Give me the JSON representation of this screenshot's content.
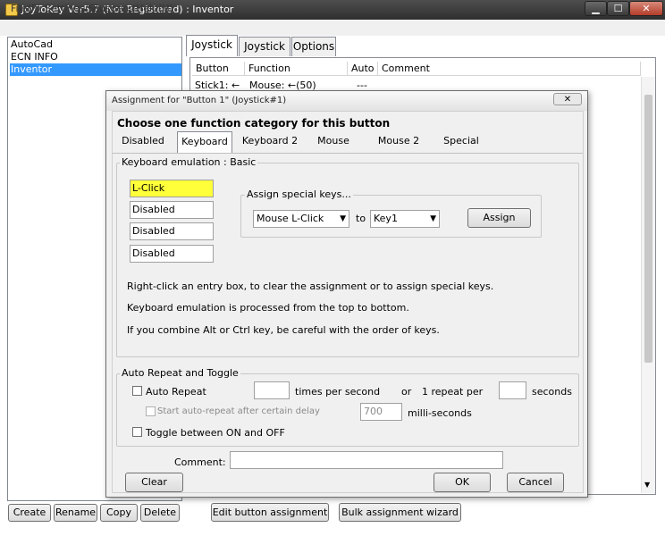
{
  "window": {
    "title": "JoyToKey Ver5.7 (Not Registered) : Inventor",
    "minimize": "▁",
    "maximize": "☐",
    "close": "✕"
  },
  "menu": [
    "File(F)",
    "Settings(S)",
    "Suspend",
    "Help(H)"
  ],
  "configs": {
    "items": [
      "AutoCad",
      "ECN INFO",
      "Inventor"
    ],
    "selected": "Inventor"
  },
  "config_buttons": [
    "Create",
    "Rename",
    "Copy",
    "Delete"
  ],
  "main_tabs": [
    "Joystick 1",
    "Joystick 2",
    "Options"
  ],
  "grid": {
    "columns": [
      "Button",
      "Function",
      "Auto",
      "Comment"
    ],
    "rows": [
      {
        "button": "Stick1: ←",
        "function": "Mouse: ←(50)",
        "auto": "---",
        "comment": ""
      }
    ]
  },
  "bottom_buttons": [
    "Edit button assignment",
    "Bulk assignment wizard"
  ],
  "dialog": {
    "title": "Assignment for \"Button 1\" (Joystick#1)",
    "close": "✕",
    "heading": "Choose one function category for this button",
    "tabs": [
      "Disabled",
      "Keyboard",
      "Keyboard 2",
      "Mouse",
      "Mouse 2",
      "Special"
    ],
    "active_tab": "Keyboard",
    "kb_group_label": "Keyboard emulation : Basic",
    "entries": [
      "L-Click",
      "Disabled",
      "Disabled",
      "Disabled"
    ],
    "special_group_label": "Assign special keys...",
    "special_from": "Mouse L-Click",
    "special_to_label": "to",
    "special_to": "Key1",
    "assign_label": "Assign",
    "help_lines": [
      "Right-click an entry box, to clear the assignment or to assign special keys.",
      "Keyboard emulation is processed from the top to bottom.",
      "If you combine Alt or Ctrl key, be careful with the order of keys."
    ],
    "auto_group_label": "Auto Repeat and Toggle",
    "auto_repeat_label": "Auto Repeat",
    "auto_repeat_value": "",
    "times_per_second": "times per second",
    "or_label": "or",
    "one_repeat_per": "1 repeat per",
    "seconds_value": "",
    "seconds_label": "seconds",
    "delay_label": "Start auto-repeat after certain delay",
    "delay_value": "700",
    "ms_label": "milli-seconds",
    "toggle_label": "Toggle between ON and OFF",
    "comment_label": "Comment:",
    "comment_value": "",
    "clear_label": "Clear",
    "ok_label": "OK",
    "cancel_label": "Cancel"
  },
  "colors": {
    "selection": "#3399ff",
    "highlight_entry": "#ffff3a"
  }
}
